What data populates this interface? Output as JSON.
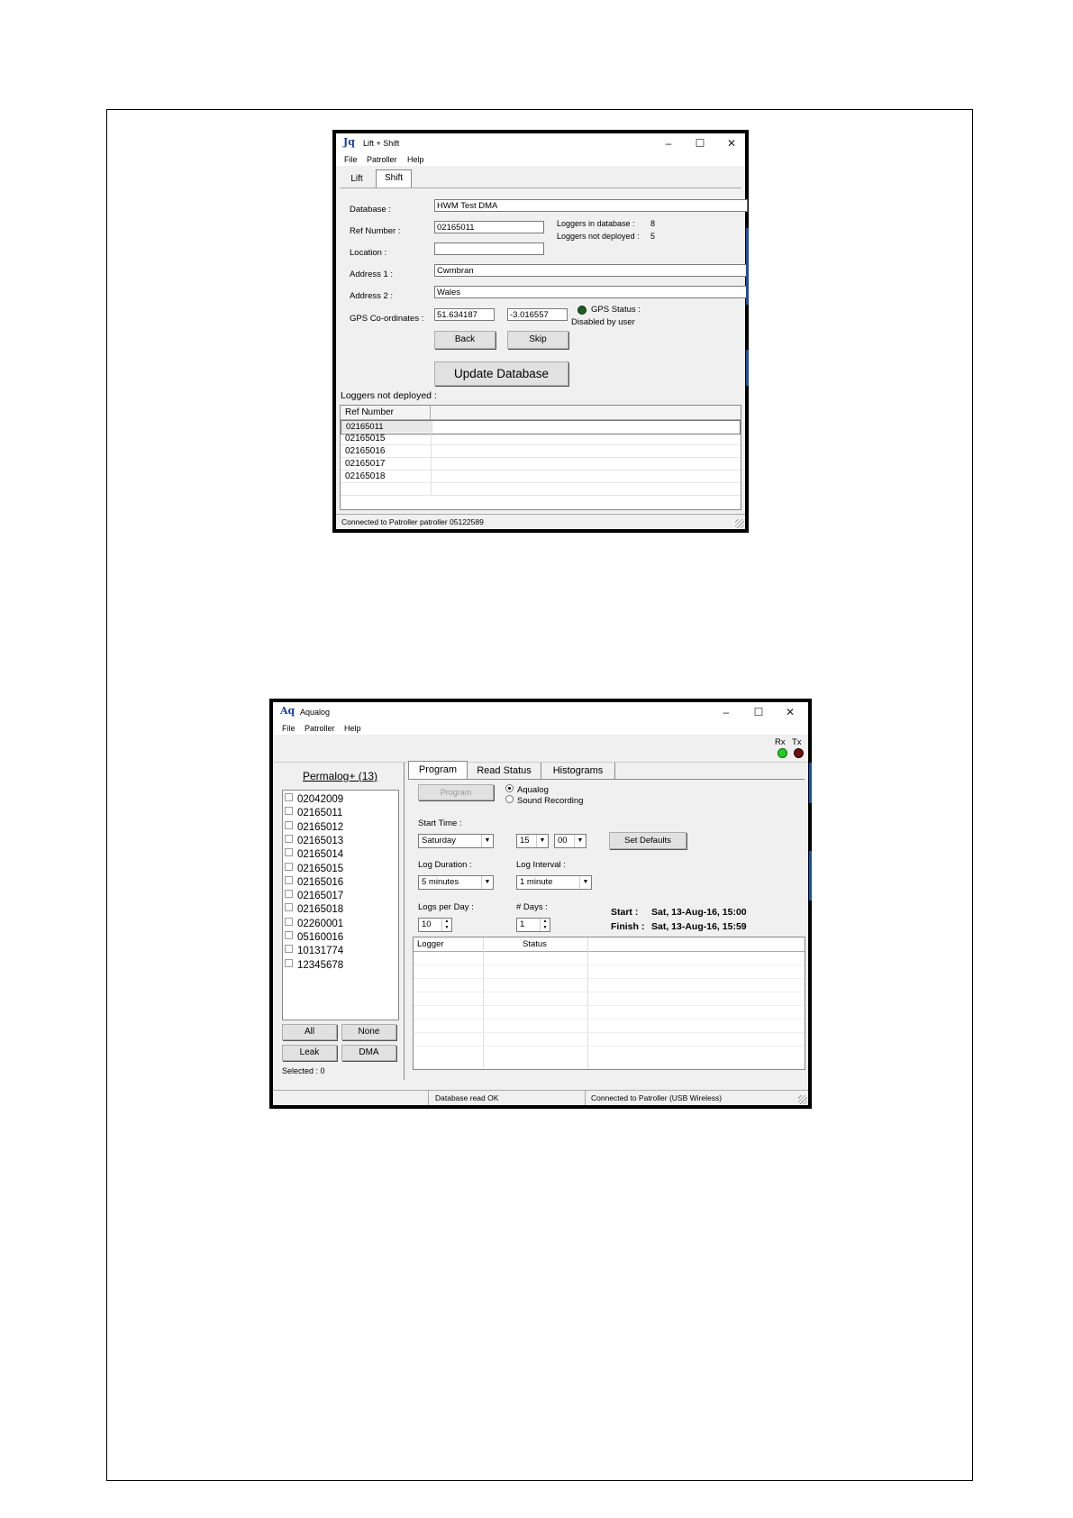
{
  "window1": {
    "title": "Lift + Shift",
    "icon_glyph": "Jq",
    "menu": [
      "File",
      "Patroller",
      "Help"
    ],
    "tabs": [
      "Lift",
      "Shift"
    ],
    "active_tab": "Shift",
    "form": {
      "database_label": "Database :",
      "database_value": "HWM Test DMA",
      "ref_label": "Ref Number :",
      "ref_value": "02165011",
      "location_label": "Location :",
      "location_value": "",
      "address1_label": "Address 1 :",
      "address1_value": "Cwmbran",
      "address2_label": "Address 2 :",
      "address2_value": "Wales",
      "gps_label": "GPS Co-ordinates :",
      "gps_lat": "51.634187",
      "gps_lon": "-3.016557",
      "loggers_in_db_label": "Loggers in database :",
      "loggers_in_db_value": "8",
      "loggers_not_deployed_label": "Loggers not deployed :",
      "loggers_not_deployed_value": "5",
      "gps_status_label": "GPS Status :",
      "gps_status_value": "Disabled by user",
      "gps_status_color": "#1f5e1f",
      "back_button": "Back",
      "skip_button": "Skip",
      "update_button": "Update Database"
    },
    "list_title": "Loggers not deployed :",
    "list_header": "Ref Number",
    "list_rows": [
      "02165011",
      "02165015",
      "02165016",
      "02165017",
      "02165018"
    ],
    "status": "Connected to Patroller patroller 05122589"
  },
  "window2": {
    "title": "Aqualog",
    "icon_glyph": "Aq",
    "menu": [
      "File",
      "Patroller",
      "Help"
    ],
    "rx_label": "Rx",
    "tx_label": "Tx",
    "rx_color": "#22cc22",
    "tx_color": "#6b0f0f",
    "group_title": "Permalog+ (13)",
    "loggers": [
      "02042009",
      "02165011",
      "02165012",
      "02165013",
      "02165014",
      "02165015",
      "02165016",
      "02165017",
      "02165018",
      "02260001",
      "05160016",
      "10131774",
      "12345678"
    ],
    "btn_all": "All",
    "btn_none": "None",
    "btn_leak": "Leak",
    "btn_dma": "DMA",
    "selected": "Selected : 0",
    "tabs": [
      "Program",
      "Read Status",
      "Histograms"
    ],
    "active_tab": "Program",
    "program_button": "Program",
    "radio_aqualog": "Aqualog",
    "radio_sound": "Sound Recording",
    "start_time_label": "Start Time :",
    "start_day": "Saturday",
    "start_hour": "15",
    "start_min": "00",
    "set_defaults": "Set Defaults",
    "log_duration_label": "Log Duration :",
    "log_duration": "5 minutes",
    "log_interval_label": "Log Interval :",
    "log_interval": "1 minute",
    "logs_per_day_label": "Logs per Day :",
    "logs_per_day": "10",
    "days_label": "# Days :",
    "days": "1",
    "start_label": "Start :",
    "start_value": "Sat, 13-Aug-16, 15:00",
    "finish_label": "Finish :",
    "finish_value": "Sat, 13-Aug-16, 15:59",
    "grid_headers": [
      "Logger",
      "Status"
    ],
    "status_db": "Database read OK",
    "status_conn": "Connected to Patroller (USB Wireless)"
  }
}
